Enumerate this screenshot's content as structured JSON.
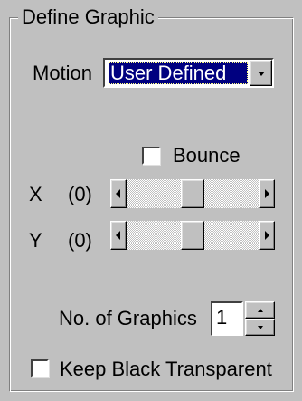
{
  "group": {
    "title": "Define Graphic"
  },
  "motion": {
    "label": "Motion",
    "selected": "User Defined"
  },
  "bounce": {
    "label": "Bounce",
    "checked": false
  },
  "x_slider": {
    "label": "X",
    "value_text": "(0)"
  },
  "y_slider": {
    "label": "Y",
    "value_text": "(0)"
  },
  "graphics_count": {
    "label": "No. of Graphics",
    "value": "1"
  },
  "keep_black": {
    "label": "Keep Black Transparent",
    "checked": false
  },
  "icons": {
    "dropdown": "chevron-down-icon",
    "scroll_left": "arrow-left-icon",
    "scroll_right": "arrow-right-icon",
    "spin_up": "arrow-up-icon",
    "spin_down": "arrow-down-icon"
  },
  "colors": {
    "face": "#c0c0c0",
    "selection": "#000080",
    "selection_text": "#ffffff"
  }
}
